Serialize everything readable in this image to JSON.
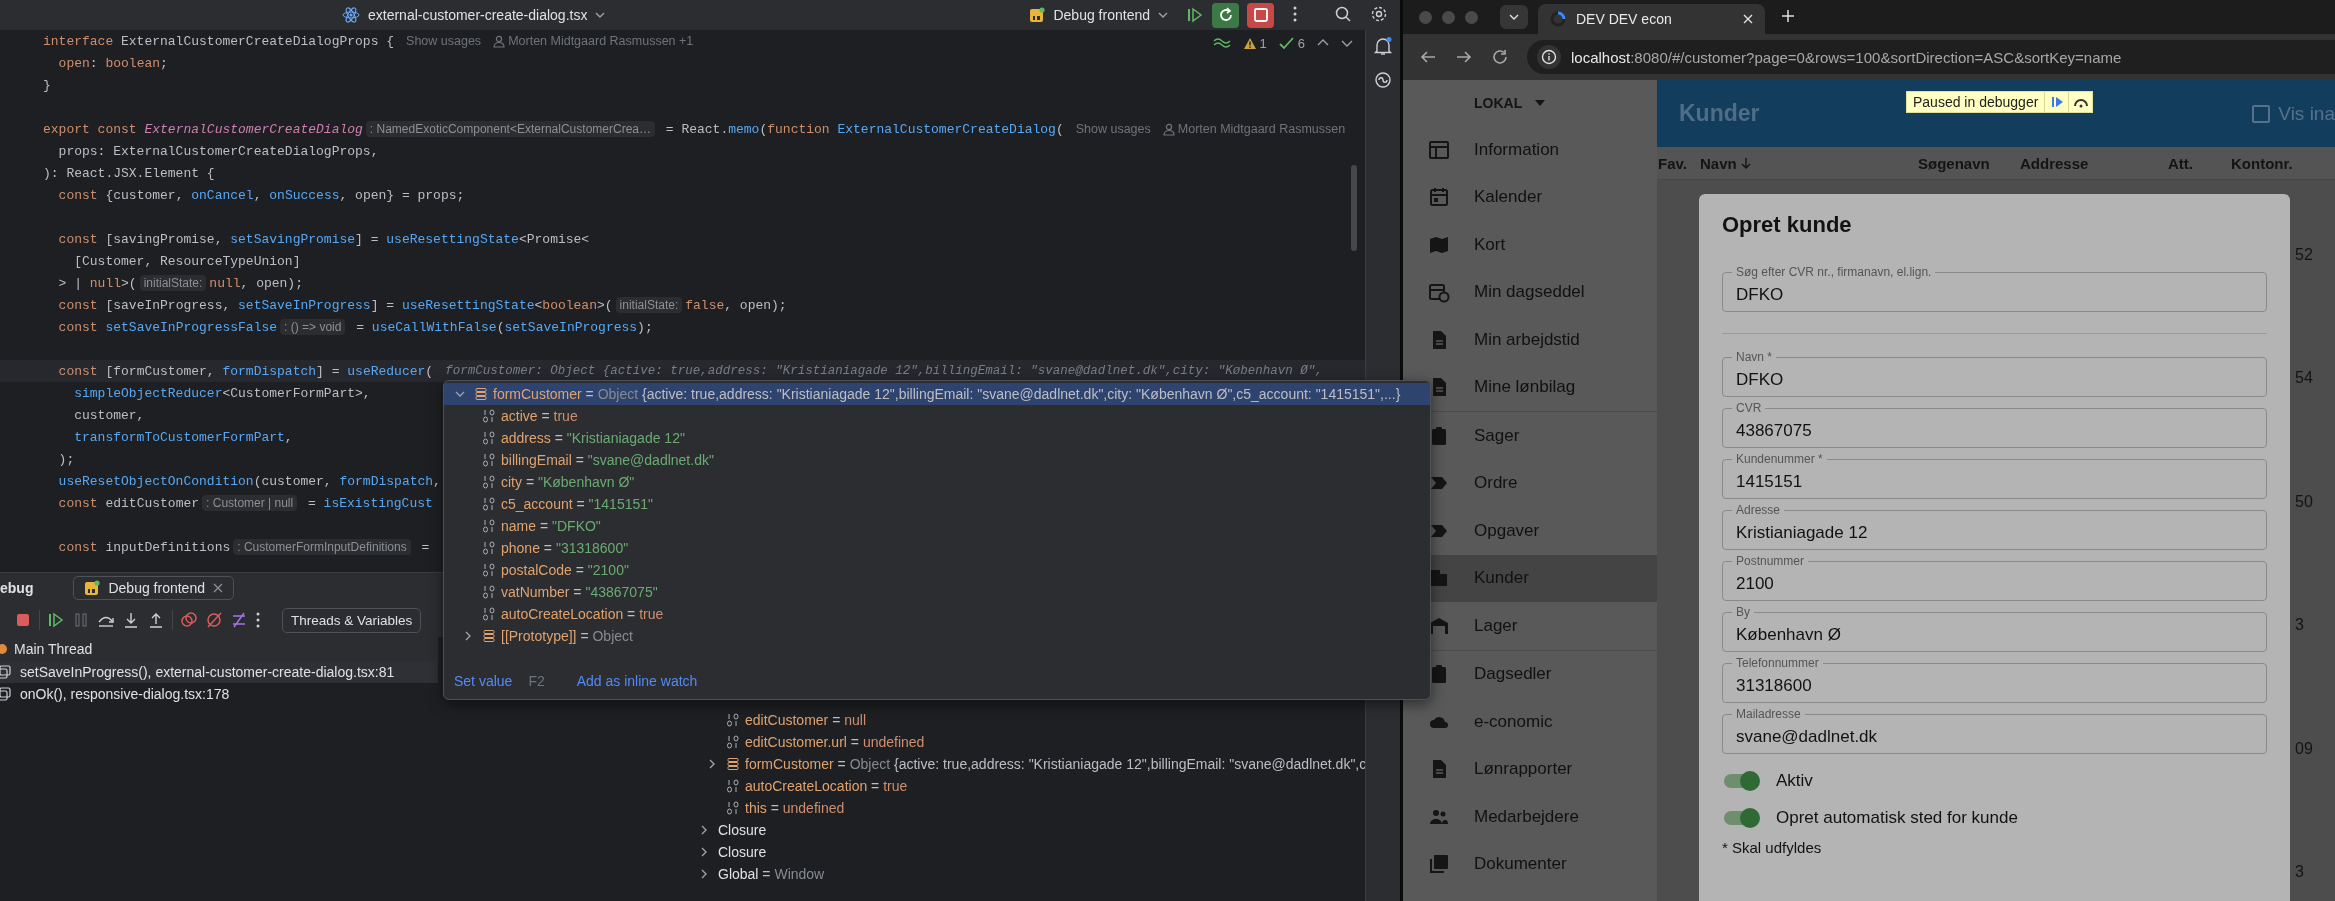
{
  "ide": {
    "title_bar": {
      "file_name": "external-customer-create-dialog.tsx",
      "run_config": "Debug frontend"
    },
    "editor": {
      "warnings": "1",
      "passed": "6",
      "lines": [
        {
          "kind": "code",
          "current": false,
          "tokens": [
            {
              "kind": "keyword",
              "text": "interface "
            },
            {
              "kind": "plain",
              "text": "ExternalCustomerCreateDialogProps {"
            }
          ],
          "annotations": [
            {
              "kind": "usages",
              "text": "Show usages"
            },
            {
              "kind": "author",
              "text": "Morten Midtgaard Rasmussen +1"
            }
          ]
        },
        {
          "kind": "code",
          "current": false,
          "tokens": [
            {
              "kind": "keyword",
              "text": "  open"
            },
            {
              "kind": "plain",
              "text": ": "
            },
            {
              "kind": "keyword",
              "text": "boolean"
            },
            {
              "kind": "plain",
              "text": ";"
            }
          ]
        },
        {
          "kind": "code",
          "current": false,
          "tokens": [
            {
              "kind": "plain",
              "text": "}"
            }
          ]
        },
        {
          "kind": "blank"
        },
        {
          "kind": "code",
          "current": false,
          "tokens": [
            {
              "kind": "keyword",
              "text": "export const "
            },
            {
              "kind": "declaration",
              "text": "ExternalCustomerCreateDialog"
            },
            {
              "kind": "hint",
              "text": ": NamedExoticComponent<ExternalCustomerCrea…"
            },
            {
              "kind": "plain",
              "text": " = React."
            },
            {
              "kind": "function",
              "text": "memo"
            },
            {
              "kind": "plain",
              "text": "("
            },
            {
              "kind": "keyword",
              "text": "function "
            },
            {
              "kind": "function",
              "text": "ExternalCustomerCreateDialog"
            },
            {
              "kind": "plain",
              "text": "("
            }
          ],
          "annotations": [
            {
              "kind": "usages",
              "text": "Show usages"
            },
            {
              "kind": "author",
              "text": "Morten Midtgaard Rasmussen"
            }
          ]
        },
        {
          "kind": "code",
          "current": false,
          "tokens": [
            {
              "kind": "plain",
              "text": "  props: ExternalCustomerCreateDialogProps,"
            }
          ]
        },
        {
          "kind": "code",
          "current": false,
          "tokens": [
            {
              "kind": "plain",
              "text": "): React.JSX.Element {"
            }
          ]
        },
        {
          "kind": "code",
          "current": false,
          "tokens": [
            {
              "kind": "keyword",
              "text": "  const "
            },
            {
              "kind": "plain",
              "text": "{customer, "
            },
            {
              "kind": "function",
              "text": "onCancel"
            },
            {
              "kind": "plain",
              "text": ", "
            },
            {
              "kind": "function",
              "text": "onSuccess"
            },
            {
              "kind": "plain",
              "text": ", open} = props;"
            }
          ]
        },
        {
          "kind": "blank"
        },
        {
          "kind": "code",
          "current": false,
          "tokens": [
            {
              "kind": "keyword",
              "text": "  const "
            },
            {
              "kind": "plain",
              "text": "[savingPromise, "
            },
            {
              "kind": "function",
              "text": "setSavingPromise"
            },
            {
              "kind": "plain",
              "text": "] = "
            },
            {
              "kind": "function",
              "text": "useResettingState"
            },
            {
              "kind": "plain",
              "text": "<Promise<"
            }
          ]
        },
        {
          "kind": "code",
          "current": false,
          "tokens": [
            {
              "kind": "plain",
              "text": "    [Customer, ResourceTypeUnion]"
            }
          ]
        },
        {
          "kind": "code",
          "current": false,
          "tokens": [
            {
              "kind": "plain",
              "text": "  > | "
            },
            {
              "kind": "keyword",
              "text": "null"
            },
            {
              "kind": "plain",
              "text": ">("
            },
            {
              "kind": "hint",
              "text": "initialState:"
            },
            {
              "kind": "keyword",
              "text": "null"
            },
            {
              "kind": "plain",
              "text": ", open);"
            }
          ]
        },
        {
          "kind": "code",
          "current": false,
          "tokens": [
            {
              "kind": "keyword",
              "text": "  const "
            },
            {
              "kind": "plain",
              "text": "[saveInProgress, "
            },
            {
              "kind": "function",
              "text": "setSaveInProgress"
            },
            {
              "kind": "plain",
              "text": "] = "
            },
            {
              "kind": "function",
              "text": "useResettingState"
            },
            {
              "kind": "plain",
              "text": "<"
            },
            {
              "kind": "keyword",
              "text": "boolean"
            },
            {
              "kind": "plain",
              "text": ">("
            },
            {
              "kind": "hint",
              "text": "initialState:"
            },
            {
              "kind": "keyword",
              "text": "false"
            },
            {
              "kind": "plain",
              "text": ", open);"
            }
          ]
        },
        {
          "kind": "code",
          "current": false,
          "tokens": [
            {
              "kind": "keyword",
              "text": "  const "
            },
            {
              "kind": "function",
              "text": "setSaveInProgressFalse"
            },
            {
              "kind": "hint",
              "text": ": () => void"
            },
            {
              "kind": "plain",
              "text": " = "
            },
            {
              "kind": "function",
              "text": "useCallWithFalse"
            },
            {
              "kind": "plain",
              "text": "("
            },
            {
              "kind": "function",
              "text": "setSaveInProgress"
            },
            {
              "kind": "plain",
              "text": ");"
            }
          ]
        },
        {
          "kind": "blank"
        },
        {
          "kind": "code",
          "current": true,
          "tokens": [
            {
              "kind": "keyword",
              "text": "  const "
            },
            {
              "kind": "plain",
              "text": "[formCustomer, "
            },
            {
              "kind": "function",
              "text": "formDispatch"
            },
            {
              "kind": "plain",
              "text": "] = "
            },
            {
              "kind": "function",
              "text": "useReducer"
            },
            {
              "kind": "plain",
              "text": "("
            },
            {
              "kind": "inline_value",
              "text": "formCustomer: Object {active: true,address: \"Kristianiagade 12\",billingEmail: \"svane@dadlnet.dk\",city: \"København Ø\","
            }
          ]
        },
        {
          "kind": "code",
          "current": false,
          "tokens": [
            {
              "kind": "function",
              "text": "    simpleObjectReducer"
            },
            {
              "kind": "plain",
              "text": "<CustomerFormPart>,"
            }
          ]
        },
        {
          "kind": "code",
          "current": false,
          "tokens": [
            {
              "kind": "plain",
              "text": "    customer,"
            }
          ]
        },
        {
          "kind": "code",
          "current": false,
          "tokens": [
            {
              "kind": "function",
              "text": "    transformToCustomerFormPart"
            },
            {
              "kind": "plain",
              "text": ","
            }
          ]
        },
        {
          "kind": "code",
          "current": false,
          "tokens": [
            {
              "kind": "plain",
              "text": "  );"
            }
          ]
        },
        {
          "kind": "code",
          "current": false,
          "tokens": [
            {
              "kind": "function",
              "text": "  useResetObjectOnCondition"
            },
            {
              "kind": "plain",
              "text": "(customer, "
            },
            {
              "kind": "function",
              "text": "formDispatch"
            },
            {
              "kind": "plain",
              "text": ","
            }
          ]
        },
        {
          "kind": "code",
          "current": false,
          "tokens": [
            {
              "kind": "keyword",
              "text": "  const "
            },
            {
              "kind": "plain",
              "text": "editCustomer"
            },
            {
              "kind": "hint",
              "text": ": Customer | null"
            },
            {
              "kind": "plain",
              "text": " = "
            },
            {
              "kind": "function",
              "text": "isExistingCust"
            }
          ]
        },
        {
          "kind": "blank"
        },
        {
          "kind": "code",
          "current": false,
          "tokens": [
            {
              "kind": "keyword",
              "text": "  const "
            },
            {
              "kind": "plain",
              "text": "inputDefinitions"
            },
            {
              "kind": "hint",
              "text": ": CustomerFormInputDefinitions"
            },
            {
              "kind": "plain",
              "text": " ="
            }
          ]
        }
      ]
    },
    "debug": {
      "tool_window": "ebug",
      "session_tab": "Debug frontend",
      "layout_button": "Threads & Variables",
      "thread": "Main Thread",
      "frames": [
        {
          "text": "setSaveInProgress(), external-customer-create-dialog.tsx:81",
          "selected": true
        },
        {
          "text": "onOk(), responsive-dialog.tsx:178",
          "selected": false
        }
      ],
      "variables": [
        {
          "kind": "literal",
          "name": "editCustomer",
          "operator": "=",
          "value": "null",
          "selected": false
        },
        {
          "kind": "literal",
          "name": "editCustomer.url",
          "operator": "=",
          "value": "undefined",
          "selected": false
        },
        {
          "kind": "object",
          "name": "formCustomer",
          "operator": "=",
          "type": "Object",
          "value": "{active: true,address: \"Kristianiagade 12\",billingEmail: \"svane@dadlnet.dk\",c",
          "expanded": false,
          "selected": false
        },
        {
          "kind": "literal",
          "name": "autoCreateLocation",
          "operator": "=",
          "value": "true",
          "selected": false
        },
        {
          "kind": "literal",
          "name": "this",
          "operator": "=",
          "value": "undefined",
          "selected": false
        },
        {
          "kind": "scope",
          "name": "Closure",
          "expanded": false,
          "selected": false
        },
        {
          "kind": "scope",
          "name": "Closure",
          "expanded": false,
          "selected": false
        },
        {
          "kind": "scope",
          "name": "Global",
          "operator": "=",
          "value": "Window",
          "expanded": false,
          "selected": false
        }
      ]
    },
    "value_popup": {
      "root": {
        "kind": "object",
        "name": "formCustomer",
        "operator": "=",
        "type": "Object",
        "value": "{active: true,address: \"Kristianiagade 12\",billingEmail: \"svane@dadlnet.dk\",city: \"København Ø\",c5_account: \"1415151\",...}",
        "expanded": true,
        "selected": true,
        "children": [
          {
            "kind": "literal",
            "name": "active",
            "operator": "=",
            "value": "true",
            "selected": false
          },
          {
            "kind": "string",
            "name": "address",
            "operator": "=",
            "value": "\"Kristianiagade 12\"",
            "selected": false
          },
          {
            "kind": "string",
            "name": "billingEmail",
            "operator": "=",
            "value": "\"svane@dadlnet.dk\"",
            "selected": false
          },
          {
            "kind": "string",
            "name": "city",
            "operator": "=",
            "value": "\"København Ø\"",
            "selected": false
          },
          {
            "kind": "string",
            "name": "c5_account",
            "operator": "=",
            "value": "\"1415151\"",
            "selected": false
          },
          {
            "kind": "string",
            "name": "name",
            "operator": "=",
            "value": "\"DFKO\"",
            "selected": false
          },
          {
            "kind": "string",
            "name": "phone",
            "operator": "=",
            "value": "\"31318600\"",
            "selected": false
          },
          {
            "kind": "string",
            "name": "postalCode",
            "operator": "=",
            "value": "\"2100\"",
            "selected": false
          },
          {
            "kind": "string",
            "name": "vatNumber",
            "operator": "=",
            "value": "\"43867075\"",
            "selected": false
          },
          {
            "kind": "literal",
            "name": "autoCreateLocation",
            "operator": "=",
            "value": "true",
            "selected": false
          },
          {
            "kind": "object",
            "name": "[[Prototype]]",
            "operator": "=",
            "type": "Object",
            "expanded": false,
            "selected": false
          }
        ]
      },
      "actions": [
        {
          "label": "Set value",
          "shortcut": "F2"
        },
        {
          "label": "Add as inline watch"
        }
      ]
    }
  },
  "browser": {
    "tab": {
      "title": "DEV DEV econ"
    },
    "address": {
      "host": "localhost",
      "path": ":8080/#/customer?page=0&rows=100&sortDirection=ASC&sortKey=name"
    },
    "app": {
      "workspace": "LOKAL",
      "sidebar": {
        "groups": [
          {
            "items": [
              {
                "label": "Information",
                "selected": false
              },
              {
                "label": "Kalender",
                "selected": false
              },
              {
                "label": "Kort",
                "selected": false
              },
              {
                "label": "Min dagseddel",
                "selected": false
              },
              {
                "label": "Min arbejdstid",
                "selected": false
              },
              {
                "label": "Mine lønbilag",
                "selected": false
              }
            ]
          },
          {
            "items": [
              {
                "label": "Sager",
                "selected": false
              },
              {
                "label": "Ordre",
                "selected": false
              },
              {
                "label": "Opgaver",
                "selected": false
              },
              {
                "label": "Kunder",
                "selected": true
              },
              {
                "label": "Lager",
                "selected": false
              }
            ]
          },
          {
            "items": [
              {
                "label": "Dagsedler",
                "selected": false
              },
              {
                "label": "e-conomic",
                "selected": false
              },
              {
                "label": "Lønrapporter",
                "selected": false
              },
              {
                "label": "Medarbejdere",
                "selected": false
              },
              {
                "label": "Dokumenter",
                "selected": false
              }
            ]
          }
        ]
      },
      "header": {
        "title": "Kunder",
        "debugger_banner": "Paused in debugger",
        "checkbox": {
          "label": "Vis ina",
          "checked": false
        }
      },
      "table": {
        "columns": [
          {
            "label": "Fav.",
            "sorted": false
          },
          {
            "label": "Navn",
            "sorted": true
          },
          {
            "label": "Søgenavn",
            "sorted": false
          },
          {
            "label": "Addresse",
            "sorted": false
          },
          {
            "label": "Att.",
            "sorted": false
          },
          {
            "label": "Kontonr.",
            "sorted": false
          }
        ],
        "rows": [
          {
            "column_7": "52"
          },
          {
            "column_7": "54"
          },
          {
            "column_7": "50"
          },
          {
            "column_7": "3"
          },
          {
            "column_7": "09"
          },
          {
            "column_7": "3"
          }
        ]
      },
      "dialog": {
        "title": "Opret kunde",
        "search": {
          "label": "Søg efter CVR nr., firmanavn, el.lign.",
          "value": "DFKO"
        },
        "fields": [
          {
            "label": "Navn *",
            "value": "DFKO"
          },
          {
            "label": "CVR",
            "value": "43867075"
          },
          {
            "label": "Kundenummer *",
            "value": "1415151"
          },
          {
            "label": "Adresse",
            "value": "Kristianiagade 12"
          },
          {
            "label": "Postnummer",
            "value": "2100"
          },
          {
            "label": "By",
            "value": "København Ø"
          },
          {
            "label": "Telefonnummer",
            "value": "31318600"
          },
          {
            "label": "Mailadresse",
            "value": "svane@dadlnet.dk"
          }
        ],
        "switches": [
          {
            "label": "Aktiv",
            "on": true
          },
          {
            "label": "Opret automatisk sted for kunde",
            "on": true
          }
        ],
        "note": "* Skal udfyldes"
      }
    }
  }
}
